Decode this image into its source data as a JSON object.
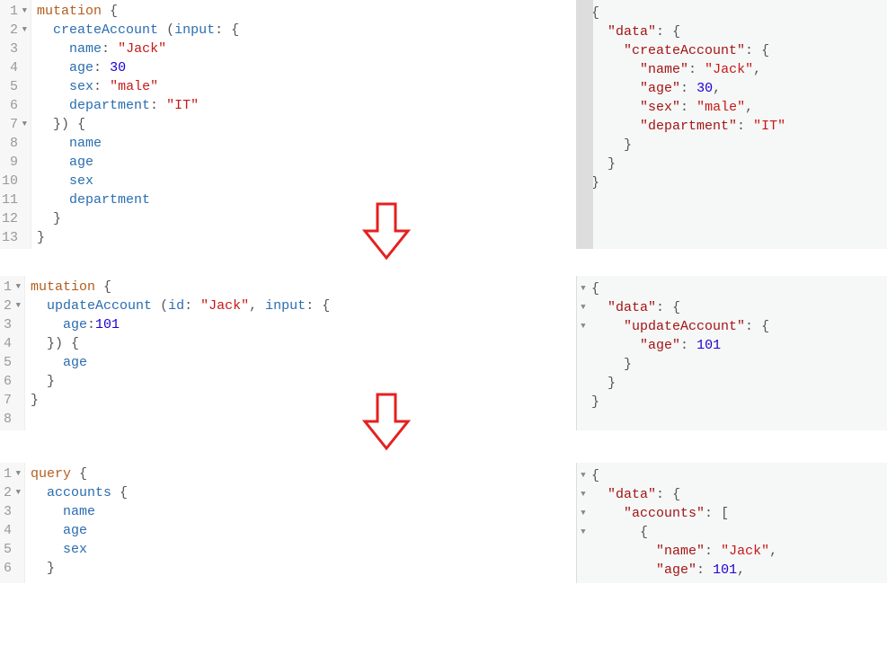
{
  "panels": {
    "p1": {
      "left": {
        "lines": [
          "1",
          "2",
          "3",
          "4",
          "5",
          "6",
          "7",
          "8",
          "9",
          "10",
          "11",
          "12",
          "13"
        ],
        "folds": [
          true,
          true,
          false,
          false,
          false,
          false,
          true,
          false,
          false,
          false,
          false,
          false,
          false
        ],
        "kw": "mutation",
        "fn": "createAccount",
        "argKey": "input",
        "f_name": "name",
        "v_name": "\"Jack\"",
        "f_age": "age",
        "v_age": "30",
        "f_sex": "sex",
        "v_sex": "\"male\"",
        "f_dept": "department",
        "v_dept": "\"IT\"",
        "sel": [
          "name",
          "age",
          "sex",
          "department"
        ]
      },
      "right": {
        "folds": [
          true,
          true,
          true,
          false,
          false,
          false,
          false,
          false,
          false,
          false
        ],
        "k_data": "\"data\"",
        "k_fn": "\"createAccount\"",
        "k_name": "\"name\"",
        "v_name": "\"Jack\"",
        "k_age": "\"age\"",
        "v_age": "30",
        "k_sex": "\"sex\"",
        "v_sex": "\"male\"",
        "k_dept": "\"department\"",
        "v_dept": "\"IT\""
      }
    },
    "p2": {
      "left": {
        "lines": [
          "1",
          "2",
          "3",
          "4",
          "5",
          "6",
          "7",
          "8"
        ],
        "folds": [
          true,
          true,
          false,
          false,
          false,
          false,
          false,
          false
        ],
        "kw": "mutation",
        "fn": "updateAccount",
        "argId": "id",
        "v_id": "\"Jack\"",
        "argInput": "input",
        "f_age": "age",
        "v_age": "101",
        "sel": [
          "age"
        ]
      },
      "right": {
        "folds": [
          true,
          true,
          true,
          false,
          false,
          false,
          false
        ],
        "k_data": "\"data\"",
        "k_fn": "\"updateAccount\"",
        "k_age": "\"age\"",
        "v_age": "101"
      }
    },
    "p3": {
      "left": {
        "lines": [
          "1",
          "2",
          "3",
          "4",
          "5",
          "6"
        ],
        "folds": [
          true,
          true,
          false,
          false,
          false,
          false
        ],
        "kw": "query",
        "fn": "accounts",
        "sel": [
          "name",
          "age",
          "sex"
        ]
      },
      "right": {
        "folds": [
          true,
          true,
          true,
          true,
          false,
          false
        ],
        "k_data": "\"data\"",
        "k_fn": "\"accounts\"",
        "k_name": "\"name\"",
        "v_name": "\"Jack\"",
        "k_age": "\"age\"",
        "v_age": "101"
      }
    }
  }
}
